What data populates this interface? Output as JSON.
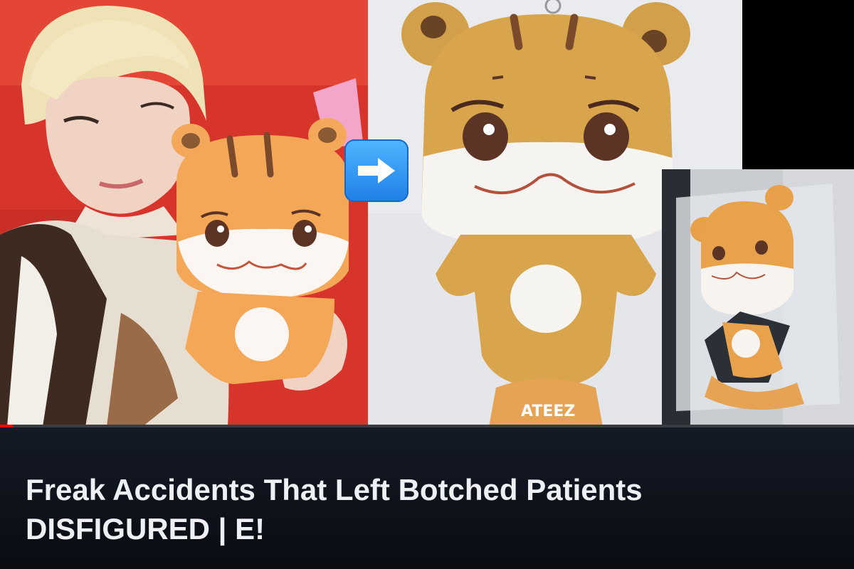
{
  "video": {
    "title_line1": "Freak Accidents That Left Botched Patients",
    "title_line2": "DISFIGURED | E!",
    "progress_fraction": 0.015
  },
  "images": {
    "left": "person-holding-plush-photo",
    "center": "plush-keychain-photo",
    "right": "packaged-plush-photo"
  },
  "icons": {
    "arrow": "right-arrow-emoji-icon"
  },
  "colors": {
    "caption_background": "#0b0d12",
    "title_text": "#eef0f3",
    "progress": "#ff0000",
    "plush_orange": "#f0a24a"
  }
}
